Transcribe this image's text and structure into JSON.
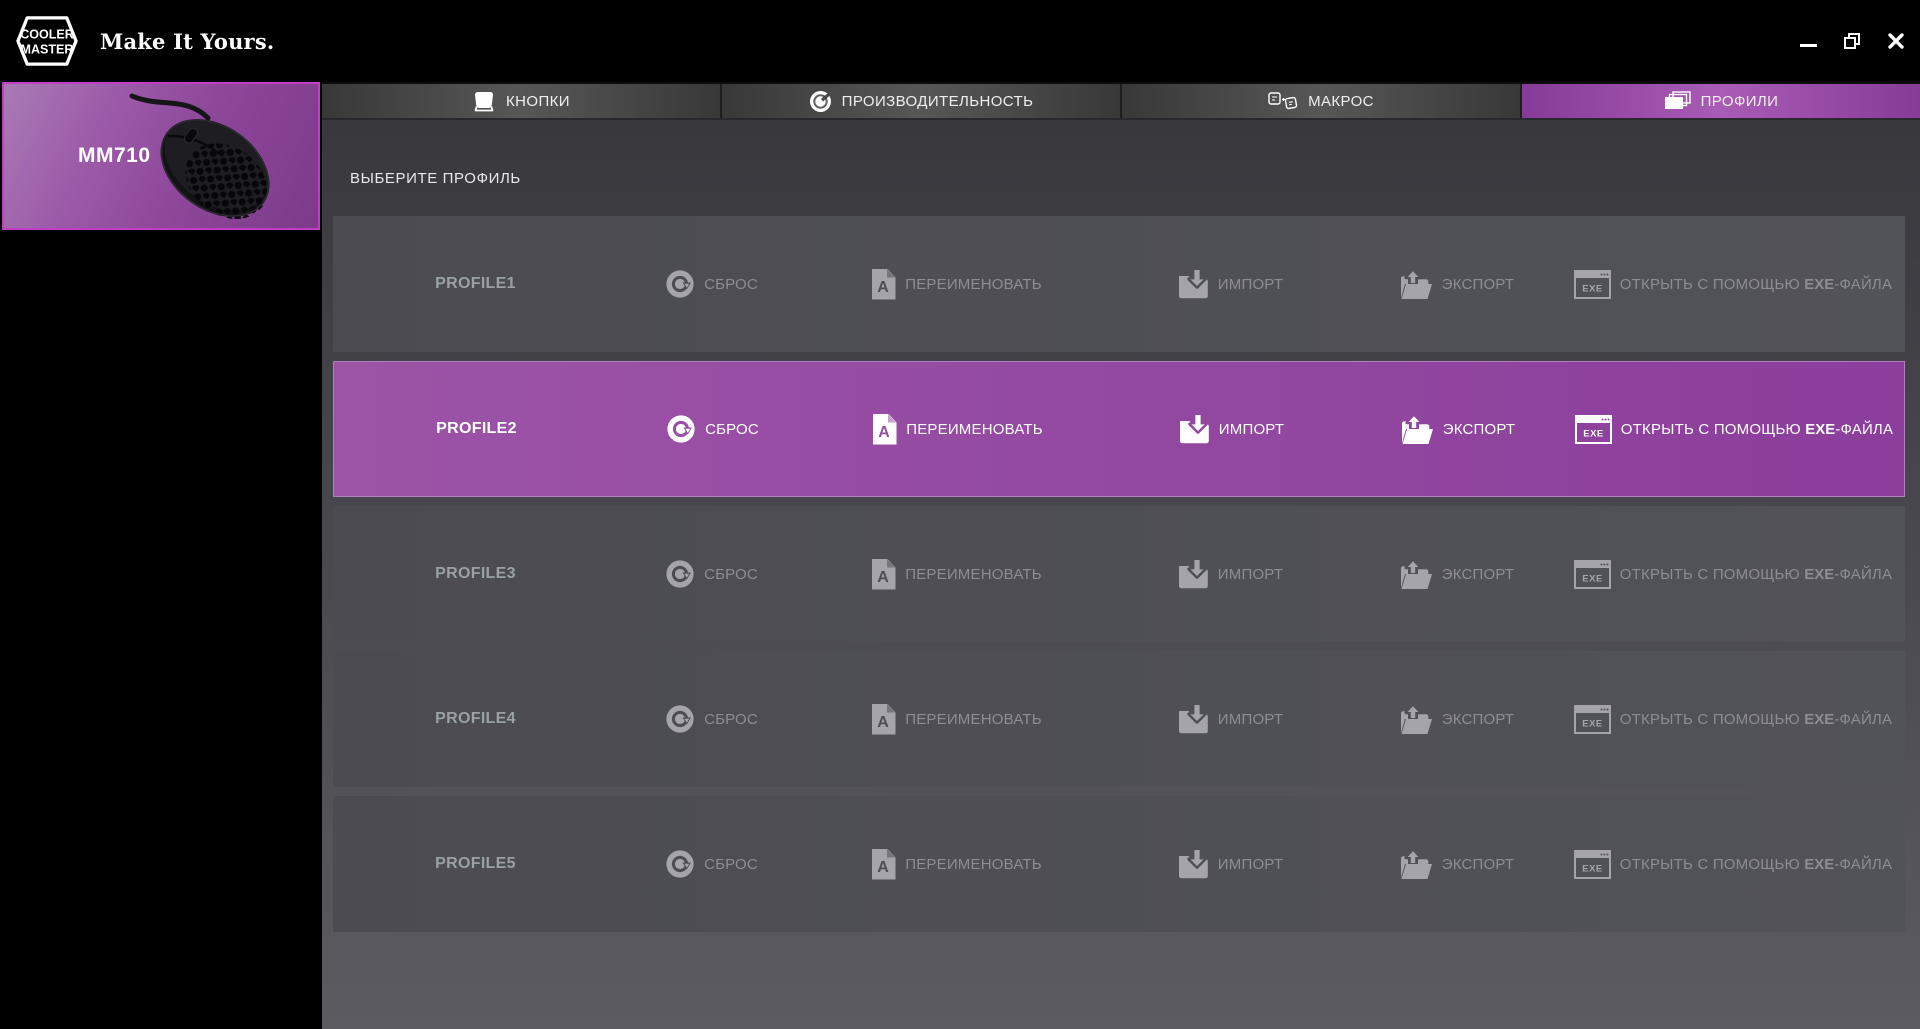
{
  "window": {
    "brand": {
      "logo_line1": "COOLER",
      "logo_line2": "MASTER",
      "tagline": "Make It Yours."
    }
  },
  "sidebar": {
    "device_name": "MM710"
  },
  "tabs": [
    {
      "label": "КНОПКИ",
      "icon": "mouse-buttons-icon",
      "active": false
    },
    {
      "label": "ПРОИЗВОДИТЕЛЬНОСТЬ",
      "icon": "gauge-icon",
      "active": false
    },
    {
      "label": "МАКРОС",
      "icon": "macro-keys-icon",
      "active": false
    },
    {
      "label": "ПРОФИЛИ",
      "icon": "profiles-stack-icon",
      "active": true
    }
  ],
  "main": {
    "heading": "ВЫБЕРИТЕ ПРОФИЛЬ"
  },
  "profiles": {
    "active_index": 1,
    "rows": [
      {
        "name": "PROFILE1"
      },
      {
        "name": "PROFILE2"
      },
      {
        "name": "PROFILE3"
      },
      {
        "name": "PROFILE4"
      },
      {
        "name": "PROFILE5"
      }
    ],
    "actions": {
      "reset": "СБРОС",
      "rename": "ПЕРЕИМЕНОВАТЬ",
      "import": "ИМПОРТ",
      "export": "ЭКСПОРТ",
      "open_exe_pre": "ОТКРЫТЬ С ПОМОЩЬЮ ",
      "open_exe_em": "EXE",
      "open_exe_post": "-ФАЙЛА"
    }
  },
  "colors": {
    "accent_purple": "#9b4fa5",
    "active_tab_purple": "#a95cb5",
    "card_border_magenta": "#c13ec1",
    "row_gray": "#4b4b51",
    "content_bg_top": "#38383d",
    "content_bg_bottom": "#5b5b61",
    "inactive_text": "#8d8d93"
  }
}
